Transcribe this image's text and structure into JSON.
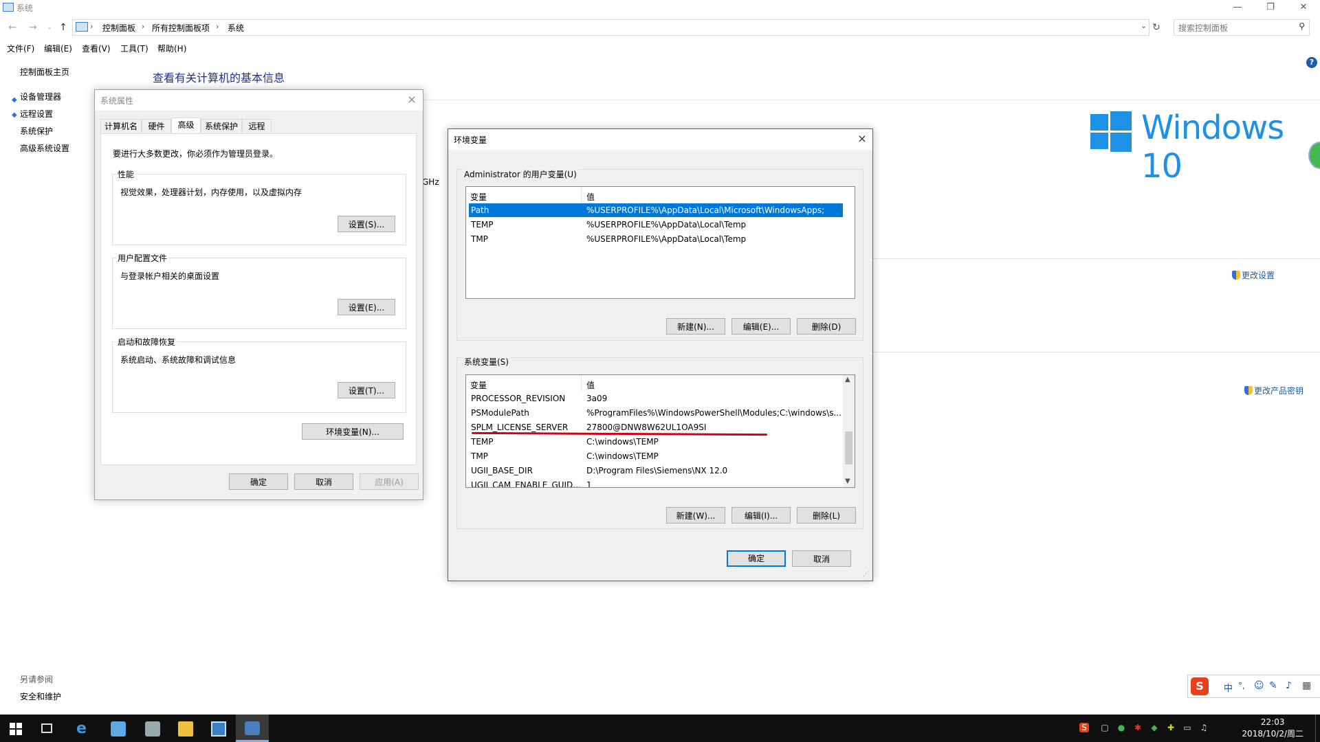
{
  "window": {
    "title": "系统",
    "controls": [
      "—",
      "❐",
      "✕"
    ]
  },
  "address": {
    "crumbs": [
      "控制面板",
      "所有控制面板项",
      "系统"
    ],
    "search_placeholder": "搜索控制面板"
  },
  "menu": [
    "文件(F)",
    "编辑(E)",
    "查看(V)",
    "工具(T)",
    "帮助(H)"
  ],
  "left_nav": {
    "home": "控制面板主页",
    "items": [
      "设备管理器",
      "远程设置",
      "系统保护",
      "高级系统设置"
    ],
    "see_also_title": "另请参阅",
    "see_also_items": [
      "安全和维护"
    ]
  },
  "main": {
    "title": "查看有关计算机的基本信息",
    "ghz_fragment": "GHz",
    "change_settings": "更改设置",
    "change_key": "更改产品密钥",
    "win_text": "Windows 10"
  },
  "sysprops": {
    "title": "系统属性",
    "tabs": [
      "计算机名",
      "硬件",
      "高级",
      "系统保护",
      "远程"
    ],
    "admin_note": "要进行大多数更改，你必须作为管理员登录。",
    "groups": [
      {
        "label": "性能",
        "desc": "视觉效果，处理器计划，内存使用，以及虚拟内存",
        "button": "设置(S)..."
      },
      {
        "label": "用户配置文件",
        "desc": "与登录帐户相关的桌面设置",
        "button": "设置(E)..."
      },
      {
        "label": "启动和故障恢复",
        "desc": "系统启动、系统故障和调试信息",
        "button": "设置(T)..."
      }
    ],
    "env_button": "环境变量(N)...",
    "ok": "确定",
    "cancel": "取消",
    "apply": "应用(A)"
  },
  "envvars": {
    "title": "环境变量",
    "user_group": "Administrator 的用户变量(U)",
    "col_var": "变量",
    "col_val": "值",
    "user_rows": [
      {
        "name": "Path",
        "value": "%USERPROFILE%\\AppData\\Local\\Microsoft\\WindowsApps;"
      },
      {
        "name": "TEMP",
        "value": "%USERPROFILE%\\AppData\\Local\\Temp"
      },
      {
        "name": "TMP",
        "value": "%USERPROFILE%\\AppData\\Local\\Temp"
      }
    ],
    "user_buttons": [
      "新建(N)...",
      "编辑(E)...",
      "删除(D)"
    ],
    "sys_group": "系统变量(S)",
    "sys_rows": [
      {
        "name": "PROCESSOR_REVISION",
        "value": "3a09"
      },
      {
        "name": "PSModulePath",
        "value": "%ProgramFiles%\\WindowsPowerShell\\Modules;C:\\windows\\s..."
      },
      {
        "name": "SPLM_LICENSE_SERVER",
        "value": "27800@DNW8W62UL1OA9SI"
      },
      {
        "name": "TEMP",
        "value": "C:\\windows\\TEMP"
      },
      {
        "name": "TMP",
        "value": "C:\\windows\\TEMP"
      },
      {
        "name": "UGII_BASE_DIR",
        "value": "D:\\Program Files\\Siemens\\NX 12.0"
      },
      {
        "name": "UGII_CAM_ENABLE_GUID...",
        "value": "1"
      }
    ],
    "sys_buttons": [
      "新建(W)...",
      "编辑(I)...",
      "删除(L)"
    ],
    "ok": "确定",
    "cancel": "取消"
  },
  "ime": {
    "lang": "中",
    "punct": "°,"
  },
  "taskbar": {
    "time": "22:03",
    "date": "2018/10/2/周二"
  },
  "colors": {
    "accent": "#0078d7",
    "title_blue": "#1e3287",
    "win_blue": "#1e90e6",
    "annotation": "#d0001b"
  }
}
